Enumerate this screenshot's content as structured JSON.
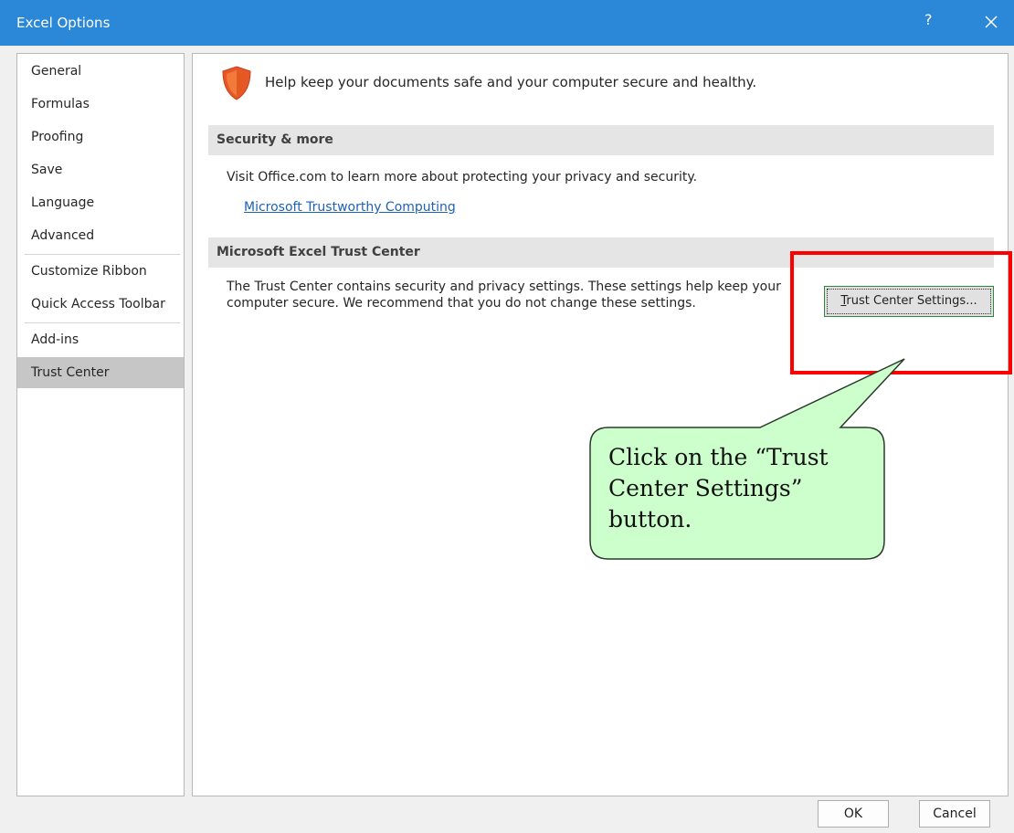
{
  "window": {
    "title": "Excel Options",
    "help_glyph": "?",
    "close_icon": "close-icon",
    "titlebar_color": "#2b88d8"
  },
  "sidebar": {
    "items": [
      {
        "label": "General"
      },
      {
        "label": "Formulas"
      },
      {
        "label": "Proofing"
      },
      {
        "label": "Save"
      },
      {
        "label": "Language"
      },
      {
        "label": "Advanced"
      },
      {
        "label": "Customize Ribbon"
      },
      {
        "label": "Quick Access Toolbar"
      },
      {
        "label": "Add-ins"
      },
      {
        "label": "Trust Center",
        "selected": true
      }
    ]
  },
  "main": {
    "shield_icon": "shield-icon",
    "intro": "Help keep your documents safe and your computer secure and healthy.",
    "security_section": {
      "header": "Security & more",
      "text": "Visit Office.com to learn more about protecting your privacy and security.",
      "link": "Microsoft Trustworthy Computing"
    },
    "trust_center_section": {
      "header": "Microsoft Excel Trust Center",
      "description": "The Trust Center contains security and privacy settings. These settings help keep your computer secure. We recommend that you do not change these settings.",
      "button_access_key": "T",
      "button_rest": "rust Center Settings..."
    }
  },
  "footer": {
    "ok_label": "OK",
    "cancel_label": "Cancel"
  },
  "annotation": {
    "callout_text": "Click on the “Trust Center Settings” button.",
    "highlight_color": "#ff0000",
    "callout_fill": "#ccffcc"
  }
}
